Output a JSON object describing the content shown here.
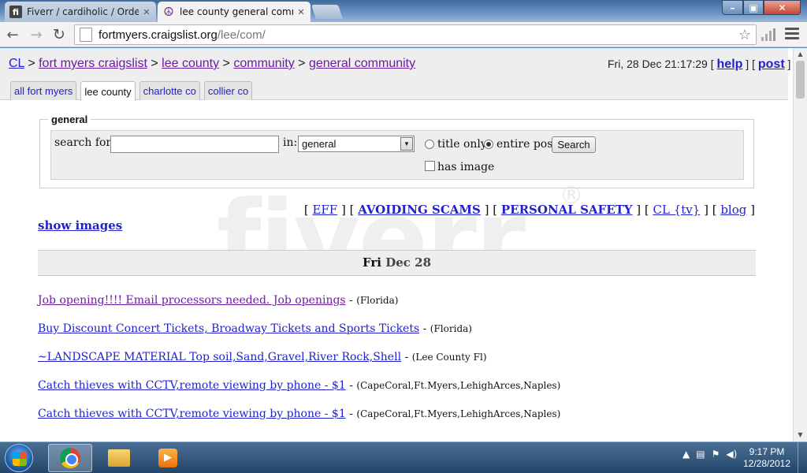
{
  "browser": {
    "tabs": [
      {
        "label": "Fiverr / cardiholic / Orders",
        "favicon": "fiverr-icon"
      },
      {
        "label": "lee county general comm",
        "favicon": "peace-icon"
      }
    ],
    "url_host": "fortmyers.craigslist.org",
    "url_path": "/lee/com/"
  },
  "header": {
    "breadcrumb": {
      "cl": "CL",
      "sep": ">",
      "site": "fort myers craigslist",
      "area": "lee county",
      "section": "community",
      "category": "general community"
    },
    "datetime": "Fri, 28 Dec 21:17:29",
    "help": "help",
    "post": "post",
    "area_tabs": [
      "all fort myers",
      "lee county",
      "charlotte co",
      "collier co"
    ]
  },
  "search": {
    "legend": "general",
    "search_for_label": "search for:",
    "query": "",
    "in_label": "in:",
    "category": "general",
    "title_only_label": "title only",
    "entire_post_label": "entire post",
    "button": "Search",
    "has_image_label": "has image"
  },
  "watermark": {
    "text": "fiverr",
    "reg": "®"
  },
  "links": {
    "eff": "EFF",
    "scams": "AVOIDING SCAMS",
    "safety": "PERSONAL SAFETY",
    "cltv": "CL {tv}",
    "blog": "blog",
    "show_images": "show images"
  },
  "date_header": {
    "day": "Fri",
    "date": "Dec 28"
  },
  "postings": [
    {
      "title": "Job opening!!!! Email processors needed. Job openings",
      "location": "(Florida)",
      "visited": true
    },
    {
      "title": "Buy Discount Concert Tickets, Broadway Tickets and Sports Tickets",
      "location": "(Florida)",
      "visited": false
    },
    {
      "title": "~LANDSCAPE MATERIAL Top soil,Sand,Gravel,River Rock,Shell",
      "location": "(Lee County Fl)",
      "visited": false
    },
    {
      "title": "Catch thieves with CCTV,remote viewing by phone - $1",
      "location": "(CapeCoral,Ft.Myers,LehighArces,Naples)",
      "visited": false
    },
    {
      "title": "Catch thieves with CCTV,remote viewing by phone - $1",
      "location": "(CapeCoral,Ft.Myers,LehighArces,Naples)",
      "visited": false
    }
  ],
  "taskbar": {
    "time": "9:17 PM",
    "date": "12/28/2012"
  }
}
